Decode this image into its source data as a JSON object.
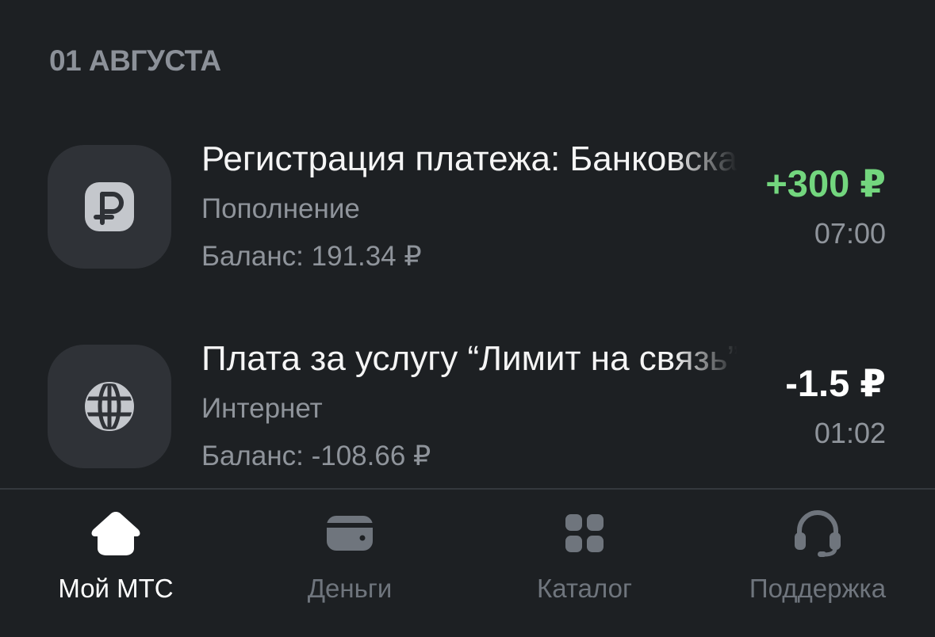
{
  "date_header": "01 АВГУСТА",
  "transactions": [
    {
      "icon": "ruble-icon",
      "title": "Регистрация платежа: Банковская карта",
      "category": "Пополнение",
      "balance": "Баланс: 191.34 ₽",
      "amount": "+300 ₽",
      "time": "07:00",
      "amount_color": "#73d67e"
    },
    {
      "icon": "globe-icon",
      "title": "Плата за услугу “Лимит на связь”",
      "category": "Интернет",
      "balance": "Баланс: -108.66 ₽",
      "amount": "-1.5 ₽",
      "time": "01:02",
      "amount_color": "#ffffff"
    }
  ],
  "tabbar": {
    "items": [
      {
        "label": "Мой МТС",
        "icon": "home-icon",
        "active": true
      },
      {
        "label": "Деньги",
        "icon": "wallet-icon",
        "active": false
      },
      {
        "label": "Каталог",
        "icon": "grid-icon",
        "active": false
      },
      {
        "label": "Поддержка",
        "icon": "headset-icon",
        "active": false
      }
    ]
  },
  "colors": {
    "background": "#1d2023",
    "icon_tile": "#2f3237",
    "secondary_text": "#8f949b",
    "inactive_tab": "#6f757d",
    "positive_amount": "#73d67e"
  }
}
